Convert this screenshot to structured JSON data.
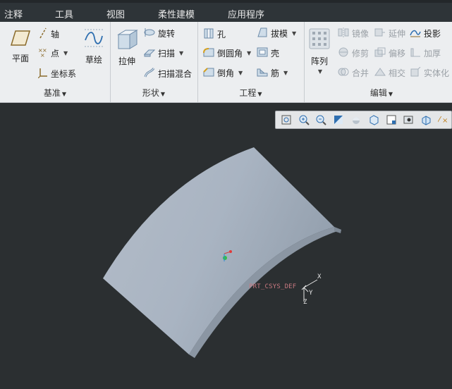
{
  "menu": {
    "items": [
      {
        "label": "注释"
      },
      {
        "label": "工具"
      },
      {
        "label": "视图"
      },
      {
        "label": "柔性建模"
      },
      {
        "label": "应用程序"
      }
    ]
  },
  "ribbon": {
    "datum": {
      "label": "基准",
      "plane": "平面",
      "axis": "轴",
      "point": "点",
      "csys": "坐标系",
      "sketch": "草绘"
    },
    "shape": {
      "label": "形状",
      "extrude": "拉伸",
      "revolve": "旋转",
      "sweep": "扫描",
      "swept_blend": "扫描混合"
    },
    "engineering": {
      "label": "工程",
      "hole": "孔",
      "round": "倒圆角",
      "chamfer": "倒角",
      "draft": "拔模",
      "shell": "壳",
      "rib": "筋"
    },
    "editing": {
      "label": "编辑",
      "pattern": "阵列",
      "mirror": "镜像",
      "trim": "修剪",
      "merge": "合并",
      "extend": "延伸",
      "offset": "偏移",
      "intersect": "相交",
      "project": "投影",
      "thicken": "加厚",
      "solidify": "实体化"
    }
  },
  "view_toolbar": {
    "icons": [
      "refit-icon",
      "zoom-in-icon",
      "zoom-out-icon",
      "repaint-icon",
      "display-style-icon",
      "saved-orientations-icon",
      "view-manager-icon",
      "perspective-icon",
      "spin-center-icon",
      "datum-display-icon"
    ]
  },
  "model": {
    "csys_name": "PRT_CSYS_DEF",
    "axis_x": "X",
    "axis_y": "Y",
    "axis_z": "Z"
  },
  "colors": {
    "menubar_bg": "#2e3438",
    "ribbon_bg": "#eceef0",
    "viewport_bg": "#2b2f31",
    "surface_top": "#a9b4c2",
    "surface_edge": "#8b96a3",
    "accent_blue": "#2f6fb0"
  }
}
